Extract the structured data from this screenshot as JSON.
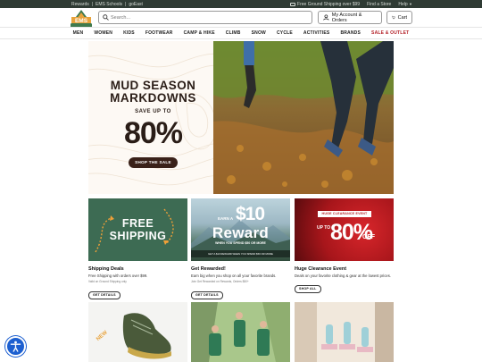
{
  "utility": {
    "links": [
      "Rewards",
      "|",
      "EMS Schools",
      "|",
      "goEast"
    ],
    "shipping": "Free Ground Shipping over $99",
    "find_store": "Find a Store",
    "help": "Help"
  },
  "header": {
    "logo_text": "EMS",
    "search_placeholder": "Search...",
    "account_label": "My Account & Orders",
    "cart_label": "Cart"
  },
  "nav": [
    "MEN",
    "WOMEN",
    "KIDS",
    "FOOTWEAR",
    "CAMP & HIKE",
    "CLIMB",
    "SNOW",
    "CYCLE",
    "ACTIVITIES",
    "BRANDS",
    "SALE & OUTLET"
  ],
  "hero": {
    "line1": "MUD SEASON",
    "line2": "MARKDOWNS",
    "save": "SAVE UP TO",
    "percent": "80%",
    "button": "SHOP THE SALE"
  },
  "cards": [
    {
      "image_text": [
        "FREE",
        "SHIPPING"
      ],
      "title": "Shipping Deals",
      "desc": "Free Shipping with orders over $99.",
      "sub": "Valid on Ground Shipping only",
      "cta": "GET DETAILS"
    },
    {
      "image_text": {
        "earn": "EARN A",
        "amount": "$10",
        "reward": "Reward",
        "when": "WHEN YOU SPEND $50 OR MORE",
        "fine": "GET A $10 REWARD WHEN YOU SPEND $50 OR MORE"
      },
      "title": "Get Rewarded!",
      "desc": "Earn big when you shop on all your favorite brands.",
      "sub": "Join Get Rewarded on Rewards, Orders $50+",
      "cta": "GET DETAILS"
    },
    {
      "image_text": {
        "badge": "HUGE CLEARANCE EVENT",
        "upto": "UP TO",
        "big": "80%",
        "off": "OFF"
      },
      "title": "Huge Clearance Event",
      "desc": "Deals on your favorite clothing & gear at the lowest prices.",
      "sub": "",
      "cta": "SHOP ALL"
    }
  ],
  "tiles": [
    "new-arrivals-shoe",
    "group-hikers",
    "yoga-class"
  ],
  "colors": {
    "utility_bg": "#2f3b34",
    "sale": "#b4232a",
    "hero_btn": "#3a2119",
    "a11y": "#1c5fd0"
  }
}
